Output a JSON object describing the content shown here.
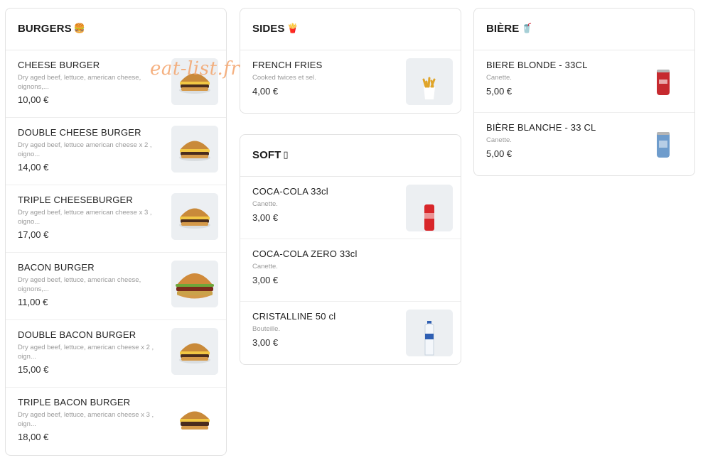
{
  "watermark": "eat-list.fr",
  "columns": [
    {
      "cards": [
        {
          "title": "BURGERS",
          "icon_glyph": "🍔",
          "icon_name": "burger-icon",
          "items": [
            {
              "name": "CHEESE BURGER",
              "desc": "Dry aged beef, lettuce, american cheese, oignons,...",
              "price": "10,00 €",
              "thumb": "burger"
            },
            {
              "name": "DOUBLE CHEESE BURGER",
              "desc": "Dry aged beef, lettuce american cheese x 2 , oigno...",
              "price": "14,00 €",
              "thumb": "burger"
            },
            {
              "name": "TRIPLE CHEESEBURGER",
              "desc": "Dry aged beef, lettuce american cheese x 3 , oigno...",
              "price": "17,00 €",
              "thumb": "burger"
            },
            {
              "name": "BACON BURGER",
              "desc": "Dry aged beef, lettuce, american cheese, oignons,...",
              "price": "11,00 €",
              "thumb": "burger-big"
            },
            {
              "name": "DOUBLE BACON BURGER",
              "desc": "Dry aged beef, lettuce, american cheese x 2 , oign...",
              "price": "15,00 €",
              "thumb": "burger"
            },
            {
              "name": "TRIPLE BACON BURGER",
              "desc": "Dry aged beef, lettuce, american cheese x 3 , oign...",
              "price": "18,00 €",
              "thumb": "burger-white"
            }
          ]
        }
      ]
    },
    {
      "cards": [
        {
          "title": "SIDES",
          "icon_glyph": "🍟",
          "icon_name": "fries-icon",
          "items": [
            {
              "name": "FRENCH FRIES",
              "desc": "Cooked twices et sel.",
              "price": "4,00 €",
              "thumb": "fries"
            }
          ]
        },
        {
          "title": "SOFT",
          "icon_glyph": "▯",
          "icon_name": "soft-drink-icon",
          "items": [
            {
              "name": "COCA-COLA 33cl",
              "desc": "Canette.",
              "price": "3,00 €",
              "thumb": "coke"
            },
            {
              "name": "COCA-COLA ZERO 33cl",
              "desc": "Canette.",
              "price": "3,00 €",
              "thumb": "none"
            },
            {
              "name": "CRISTALLINE 50 cl",
              "desc": "Bouteille.",
              "price": "3,00 €",
              "thumb": "water"
            }
          ]
        }
      ]
    },
    {
      "cards": [
        {
          "title": "BIÈRE",
          "icon_glyph": "🥤",
          "icon_name": "beer-glass-icon",
          "items": [
            {
              "name": "BIERE BLONDE - 33CL",
              "desc": "Canette.",
              "price": "5,00 €",
              "thumb": "can-red"
            },
            {
              "name": "BIÈRE BLANCHE - 33 CL",
              "desc": "Canette.",
              "price": "5,00 €",
              "thumb": "can-blue"
            }
          ]
        }
      ]
    }
  ]
}
